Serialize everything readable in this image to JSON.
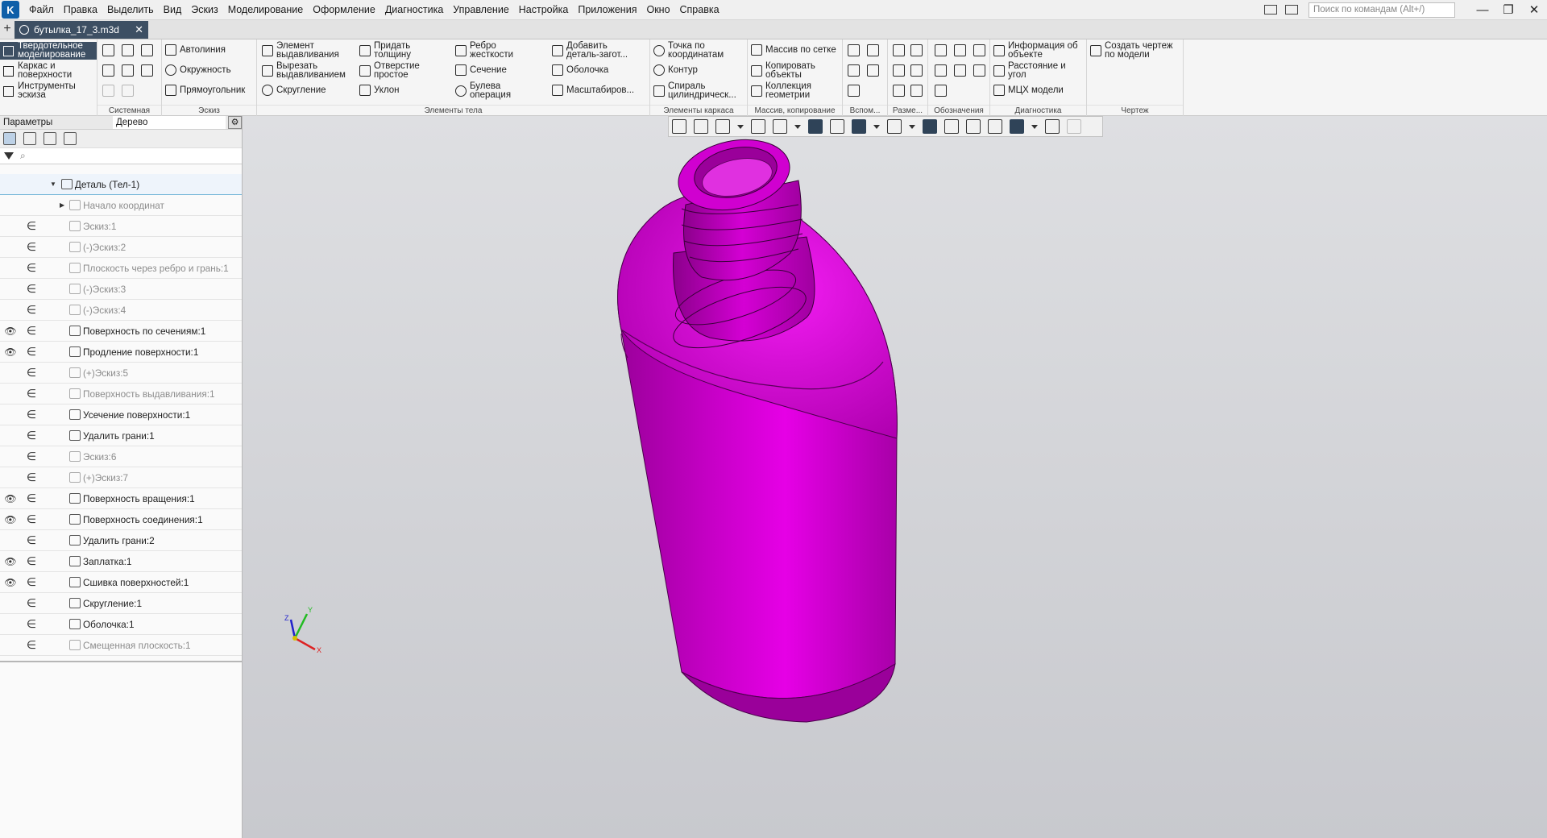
{
  "menubar": {
    "logo": "K",
    "items": [
      "Файл",
      "Правка",
      "Выделить",
      "Вид",
      "Эскиз",
      "Моделирование",
      "Оформление",
      "Диагностика",
      "Управление",
      "Настройка",
      "Приложения",
      "Окно",
      "Справка"
    ],
    "search_placeholder": "Поиск по командам (Alt+/)",
    "win_minimize": "—",
    "win_restore": "❐",
    "win_close": "✕"
  },
  "tabs": {
    "add": "+",
    "document": "бутылка_17_3.m3d",
    "close": "✕"
  },
  "ribbon": {
    "modes": [
      "Твердотельное\nмоделирование",
      "Каркас и\nповерхности",
      "Инструменты\nэскиза"
    ],
    "groups": [
      "Системная",
      "Эскиз",
      "Элементы тела",
      "Элементы каркаса",
      "Массив, копирование",
      "Вспом...",
      "Разме...",
      "Обозначения",
      "Диагностика",
      "Чертеж"
    ],
    "sketch_buttons": [
      "Автолиния",
      "Окружность",
      "Прямоугольник"
    ],
    "body_buttons": [
      "Элемент\nвыдавливания",
      "Вырезать\nвыдавливанием",
      "Скругление",
      "Придать\nтолщину",
      "Отверстие\nпростое",
      "Уклон",
      "Ребро\nжесткости",
      "Сечение",
      "Булева\nоперация",
      "Добавить\nдеталь-загот...",
      "Оболочка",
      "Масштабиров..."
    ],
    "frame_buttons": [
      "Точка по\nкоординатам",
      "Контур",
      "Спираль\nцилиндрическ..."
    ],
    "array_buttons": [
      "Массив по сетке",
      "Копировать\nобъекты",
      "Коллекция\nгеометрии"
    ],
    "diag_buttons": [
      "Информация об\nобъекте",
      "Расстояние и\nугол",
      "МЦХ модели"
    ],
    "drawing_buttons": [
      "Создать чертеж\nпо модели"
    ]
  },
  "panel": {
    "tab_params": "Параметры",
    "tab_tree": "Дерево",
    "gear": "⚙",
    "filter_glyph": "⌕",
    "tree": [
      {
        "label": "Деталь (Тел-1)",
        "state": "root",
        "visible": false
      },
      {
        "label": "Начало координат",
        "state": "dim",
        "visible": false
      },
      {
        "label": "Эскиз:1",
        "state": "dim",
        "visible": false
      },
      {
        "label": "(-)Эскиз:2",
        "state": "dim",
        "visible": false
      },
      {
        "label": "Плоскость через ребро и грань:1",
        "state": "dim",
        "visible": false
      },
      {
        "label": "(-)Эскиз:3",
        "state": "dim",
        "visible": false
      },
      {
        "label": "(-)Эскиз:4",
        "state": "dim",
        "visible": false
      },
      {
        "label": "Поверхность по сечениям:1",
        "state": "normal",
        "visible": true
      },
      {
        "label": "Продление поверхности:1",
        "state": "normal",
        "visible": true
      },
      {
        "label": "(+)Эскиз:5",
        "state": "dim",
        "visible": false
      },
      {
        "label": "Поверхность выдавливания:1",
        "state": "dim",
        "visible": false
      },
      {
        "label": "Усечение поверхности:1",
        "state": "normal",
        "visible": false
      },
      {
        "label": "Удалить грани:1",
        "state": "normal",
        "visible": false
      },
      {
        "label": "Эскиз:6",
        "state": "dim",
        "visible": false
      },
      {
        "label": "(+)Эскиз:7",
        "state": "dim",
        "visible": false
      },
      {
        "label": "Поверхность вращения:1",
        "state": "normal",
        "visible": true
      },
      {
        "label": "Поверхность соединения:1",
        "state": "normal",
        "visible": true
      },
      {
        "label": "Удалить грани:2",
        "state": "normal",
        "visible": false
      },
      {
        "label": "Заплатка:1",
        "state": "normal",
        "visible": true
      },
      {
        "label": "Сшивка поверхностей:1",
        "state": "normal",
        "visible": true
      },
      {
        "label": "Скругление:1",
        "state": "normal",
        "visible": false
      },
      {
        "label": "Оболочка:1",
        "state": "normal",
        "visible": false
      },
      {
        "label": "Смещенная плоскость:1",
        "state": "dim",
        "visible": false
      }
    ],
    "eye_glyph": "👁",
    "rel_glyph": "∈"
  },
  "viewport": {
    "model_color": "#c800c8",
    "axes": {
      "x": "X",
      "y": "Y",
      "z": "Z"
    }
  }
}
